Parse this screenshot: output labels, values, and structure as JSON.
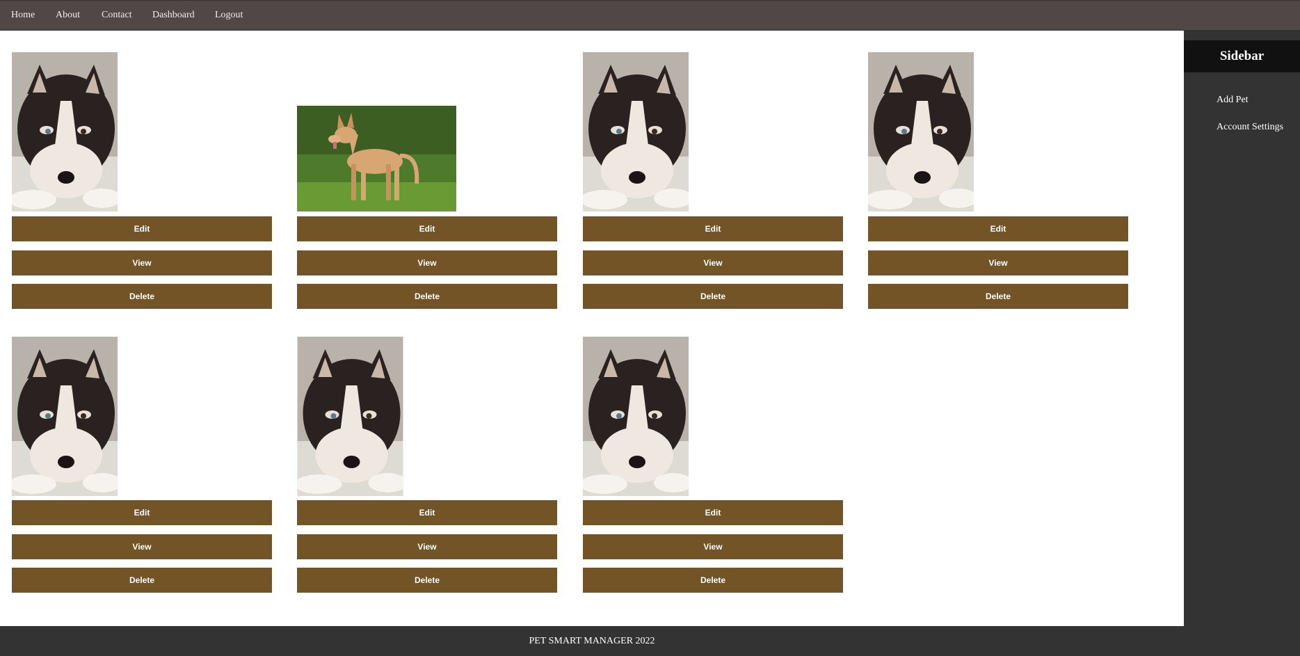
{
  "nav": {
    "items": [
      {
        "label": "Home"
      },
      {
        "label": "About"
      },
      {
        "label": "Contact"
      },
      {
        "label": "Dashboard"
      },
      {
        "label": "Logout"
      }
    ]
  },
  "sidebar": {
    "title": "Sidebar",
    "items": [
      {
        "label": "Add Pet"
      },
      {
        "label": "Account Settings"
      }
    ]
  },
  "pets": [
    {
      "photo": "husky-puppy",
      "edit_label": "Edit",
      "view_label": "View",
      "delete_label": "Delete"
    },
    {
      "photo": "tan-dog-on-grass",
      "edit_label": "Edit",
      "view_label": "View",
      "delete_label": "Delete"
    },
    {
      "photo": "husky-puppy",
      "edit_label": "Edit",
      "view_label": "View",
      "delete_label": "Delete"
    },
    {
      "photo": "husky-puppy",
      "edit_label": "Edit",
      "view_label": "View",
      "delete_label": "Delete"
    },
    {
      "photo": "husky-puppy",
      "edit_label": "Edit",
      "view_label": "View",
      "delete_label": "Delete"
    },
    {
      "photo": "husky-puppy",
      "edit_label": "Edit",
      "view_label": "View",
      "delete_label": "Delete"
    },
    {
      "photo": "husky-puppy",
      "edit_label": "Edit",
      "view_label": "View",
      "delete_label": "Delete"
    }
  ],
  "footer": {
    "text": "PET SMART MANAGER 2022"
  },
  "colors": {
    "navbar": "#524747",
    "sidebar": "#333333",
    "sidebar_header": "#111111",
    "button": "#735427",
    "footer": "#333333"
  }
}
